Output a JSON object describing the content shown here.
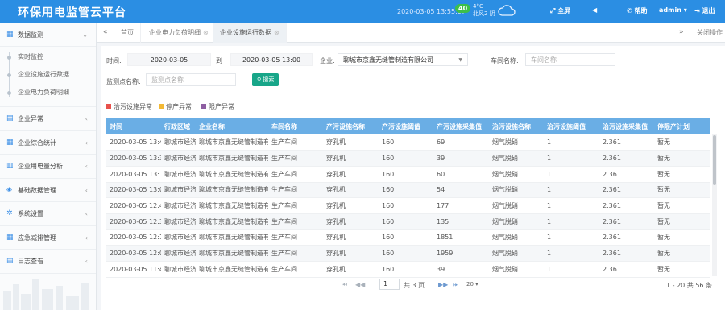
{
  "header": {
    "title": "环保用电监管云平台",
    "datetime": "2020-03-05 13:55:07",
    "aqi": "40",
    "temperature": "4°C",
    "wind": "北风2 阴",
    "fullscreen_label": "全屏",
    "help_label": "帮助",
    "user_label": "admin",
    "logout_label": "退出",
    "brand_color": "#2b8ee3"
  },
  "sidebar": {
    "top": {
      "label": "数据监测"
    },
    "subitems": [
      {
        "label": "实时监控"
      },
      {
        "label": "企业设施运行数据"
      },
      {
        "label": "企业电力负荷明细"
      }
    ],
    "groups": [
      {
        "label": "企业异常",
        "icon": "document-icon"
      },
      {
        "label": "企业综合统计",
        "icon": "calendar-icon"
      },
      {
        "label": "企业用电量分析",
        "icon": "bar-chart-icon"
      },
      {
        "label": "基础数据管理",
        "icon": "layers-icon"
      },
      {
        "label": "系统设置",
        "icon": "gear-icon"
      },
      {
        "label": "应急减排管理",
        "icon": "calendar-icon"
      },
      {
        "label": "日志查看",
        "icon": "document-icon"
      }
    ]
  },
  "tabs": {
    "home": "首页",
    "items": [
      {
        "label": "企业电力负荷明细"
      },
      {
        "label": "企业设施运行数据"
      }
    ],
    "close_ops": "关闭操作"
  },
  "filters": {
    "time_label": "时间:",
    "start": "2020-03-05",
    "to": "到",
    "end": "2020-03-05 13:00",
    "company_label": "企业:",
    "company_value": "聊城市京鑫无缝管制造有限公司",
    "workshop_label": "车间名称:",
    "workshop_placeholder": "车间名称",
    "point_label": "监测点名称:",
    "point_placeholder": "监测点名称",
    "search_label": "搜索"
  },
  "legend": [
    {
      "label": "治污设施异常",
      "color": "#e8514b"
    },
    {
      "label": "停产异常",
      "color": "#f3b935"
    },
    {
      "label": "限产异常",
      "color": "#8e5ea2"
    }
  ],
  "table": {
    "columns": [
      "时间",
      "行政区域",
      "企业名称",
      "车间名称",
      "产污设施名称",
      "产污设施阈值",
      "产污设施采集值",
      "治污设施名称",
      "治污设施阈值",
      "治污设施采集值",
      "停限产计划"
    ],
    "rows": [
      [
        "2020-03-05 13:45",
        "聊城市经济",
        "聊城市京鑫无缝管制造有",
        "生产车间",
        "穿孔机",
        "160",
        "69",
        "烟气脱硝",
        "1",
        "2.361",
        "暂无"
      ],
      [
        "2020-03-05 13:30",
        "聊城市经济",
        "聊城市京鑫无缝管制造有",
        "生产车间",
        "穿孔机",
        "160",
        "39",
        "烟气脱硝",
        "1",
        "2.361",
        "暂无"
      ],
      [
        "2020-03-05 13:15",
        "聊城市经济",
        "聊城市京鑫无缝管制造有",
        "生产车间",
        "穿孔机",
        "160",
        "60",
        "烟气脱硝",
        "1",
        "2.361",
        "暂无"
      ],
      [
        "2020-03-05 13:00",
        "聊城市经济",
        "聊城市京鑫无缝管制造有",
        "生产车间",
        "穿孔机",
        "160",
        "54",
        "烟气脱硝",
        "1",
        "2.361",
        "暂无"
      ],
      [
        "2020-03-05 12:45",
        "聊城市经济",
        "聊城市京鑫无缝管制造有",
        "生产车间",
        "穿孔机",
        "160",
        "177",
        "烟气脱硝",
        "1",
        "2.361",
        "暂无"
      ],
      [
        "2020-03-05 12:30",
        "聊城市经济",
        "聊城市京鑫无缝管制造有",
        "生产车间",
        "穿孔机",
        "160",
        "135",
        "烟气脱硝",
        "1",
        "2.361",
        "暂无"
      ],
      [
        "2020-03-05 12:15",
        "聊城市经济",
        "聊城市京鑫无缝管制造有",
        "生产车间",
        "穿孔机",
        "160",
        "1851",
        "烟气脱硝",
        "1",
        "2.361",
        "暂无"
      ],
      [
        "2020-03-05 12:00",
        "聊城市经济",
        "聊城市京鑫无缝管制造有",
        "生产车间",
        "穿孔机",
        "160",
        "1959",
        "烟气脱硝",
        "1",
        "2.361",
        "暂无"
      ],
      [
        "2020-03-05 11:45",
        "聊城市经济",
        "聊城市京鑫无缝管制造有",
        "生产车间",
        "穿孔机",
        "160",
        "39",
        "烟气脱硝",
        "1",
        "2.361",
        "暂无"
      ]
    ]
  },
  "pager": {
    "current": "1",
    "total_pages": "共 3 页",
    "page_size": "20",
    "info": "1 - 20   共 56 条"
  }
}
